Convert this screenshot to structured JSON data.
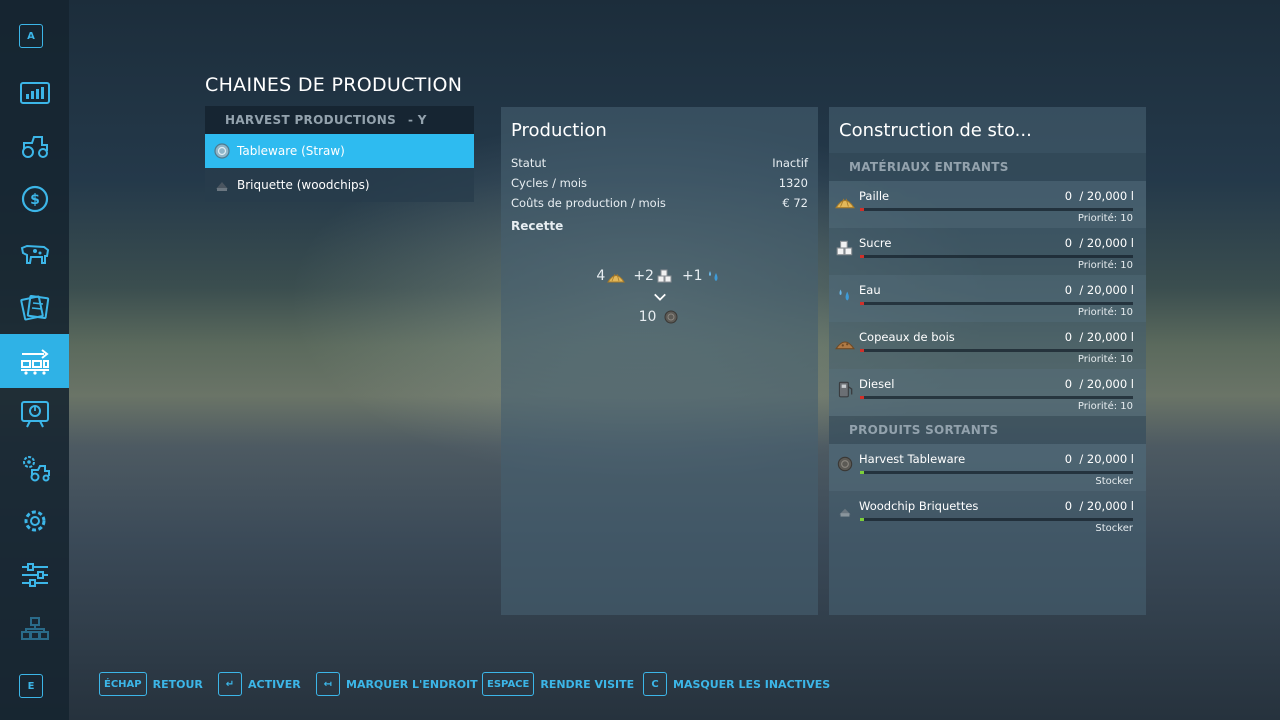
{
  "sidebar": {
    "top_key": "A",
    "bottom_key": "E",
    "items": [
      {
        "icon": "statistics-icon"
      },
      {
        "icon": "tractor-icon"
      },
      {
        "icon": "finance-icon"
      },
      {
        "icon": "animals-icon"
      },
      {
        "icon": "contracts-icon"
      },
      {
        "icon": "production-chains-icon",
        "active": true
      },
      {
        "icon": "tour-icon"
      },
      {
        "icon": "vehicle-settings-icon"
      },
      {
        "icon": "settings-icon"
      },
      {
        "icon": "general-settings-icon"
      },
      {
        "icon": "help-icon"
      }
    ],
    "accent": "#2fb2e6"
  },
  "page_title": "CHAINES DE PRODUCTION",
  "production_list": {
    "header": "HARVEST PRODUCTIONS",
    "header_suffix": "- Y",
    "items": [
      {
        "label": "Tableware (Straw)",
        "selected": true
      },
      {
        "label": "Briquette (woodchips)",
        "selected": false
      }
    ]
  },
  "production_panel": {
    "title": "Production",
    "stats": [
      {
        "label": "Statut",
        "value": "Inactif"
      },
      {
        "label": "Cycles / mois",
        "value": "1320"
      },
      {
        "label": "Coûts de production / mois",
        "value": "€ 72"
      }
    ],
    "recipe_label": "Recette",
    "recipe": {
      "inputs": [
        {
          "amount": "4",
          "icon": "straw-icon"
        },
        {
          "amount": "+2",
          "icon": "sugar-icon"
        },
        {
          "amount": "+1",
          "icon": "water-icon"
        }
      ],
      "output": {
        "amount": "10",
        "icon": "tableware-icon"
      }
    }
  },
  "storage_panel": {
    "title": "Construction de sto...",
    "inputs_header": "MATÉRIAUX ENTRANTS",
    "inputs": [
      {
        "name": "Paille",
        "amount": "0",
        "capacity": "/ 20,000 l",
        "note": "Priorité: 10",
        "icon": "straw-icon"
      },
      {
        "name": "Sucre",
        "amount": "0",
        "capacity": "/ 20,000 l",
        "note": "Priorité: 10",
        "icon": "sugar-icon"
      },
      {
        "name": "Eau",
        "amount": "0",
        "capacity": "/ 20,000 l",
        "note": "Priorité: 10",
        "icon": "water-icon"
      },
      {
        "name": "Copeaux de bois",
        "amount": "0",
        "capacity": "/ 20,000 l",
        "note": "Priorité: 10",
        "icon": "woodchips-icon"
      },
      {
        "name": "Diesel",
        "amount": "0",
        "capacity": "/ 20,000 l",
        "note": "Priorité: 10",
        "icon": "diesel-icon"
      }
    ],
    "outputs_header": "PRODUITS SORTANTS",
    "outputs": [
      {
        "name": "Harvest Tableware",
        "amount": "0",
        "capacity": "/ 20,000 l",
        "note": "Stocker",
        "icon": "tableware-icon"
      },
      {
        "name": "Woodchip Briquettes",
        "amount": "0",
        "capacity": "/ 20,000 l",
        "note": "Stocker",
        "icon": "briquette-icon"
      }
    ],
    "input_bar_color": "#d0302a",
    "output_bar_color": "#7ccf3a"
  },
  "footer": {
    "hints": [
      {
        "key": "ÉCHAP",
        "label": "RETOUR"
      },
      {
        "key": "↵",
        "label": "ACTIVER"
      },
      {
        "key": "↤",
        "label": "MARQUER L'ENDROIT"
      },
      {
        "key": "ESPACE",
        "label": "RENDRE VISITE"
      },
      {
        "key": "C",
        "label": "MASQUER LES INACTIVES"
      }
    ]
  }
}
